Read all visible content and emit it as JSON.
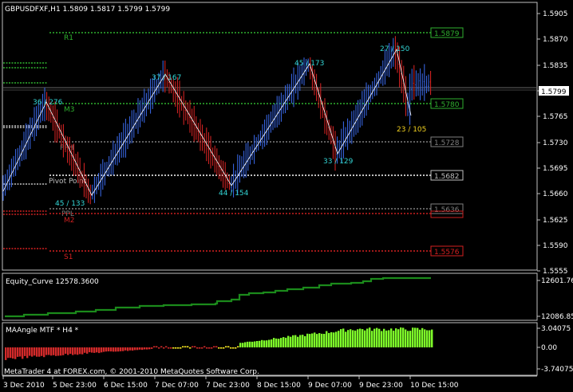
{
  "main_chart": {
    "header": "GBPUSDFXF,H1  1.5809 1.5817 1.5799 1.5799",
    "price_scale": [
      "1.5905",
      "1.5870",
      "1.5835",
      "1.5800",
      "1.5765",
      "1.5730",
      "1.5695",
      "1.5660",
      "1.5625",
      "1.5590",
      "1.5555"
    ],
    "current_price": "1.5799",
    "levels": [
      {
        "label": "R1",
        "price": "1.5879",
        "label_color": "#2fb12f",
        "line_color": "#2fb12f"
      },
      {
        "label": "M3",
        "price": "1.5780",
        "label_color": "#2fb12f",
        "line_color": "#2fb12f"
      },
      {
        "label": "PPH",
        "price": "1.5728",
        "label_color": "#7f7f7f",
        "line_color": "#7f7f7f"
      },
      {
        "label": "Pivot Point",
        "price": "1.5682",
        "label_color": "#bfbfbf",
        "line_color": "#bfbfbf"
      },
      {
        "label": "PPL",
        "price": "1.5636",
        "label_color": "#7f7f7f",
        "line_color": "#7f7f7f"
      },
      {
        "label": "M2",
        "price": "",
        "label_color": "#cc2020",
        "line_color": "#cc2020"
      },
      {
        "label": "S1",
        "price": "1.5576",
        "label_color": "#d42020",
        "line_color": "#d42020"
      }
    ],
    "zigzag_labels": [
      {
        "text": "36 / 276",
        "color": "#33d6d6"
      },
      {
        "text": "45 / 133",
        "color": "#33d6d6"
      },
      {
        "text": "37 / 167",
        "color": "#33d6d6"
      },
      {
        "text": "44 / 154",
        "color": "#33d6d6"
      },
      {
        "text": "45 / 173",
        "color": "#33d6d6"
      },
      {
        "text": "33 / 129",
        "color": "#33d6d6"
      },
      {
        "text": "27 / 150",
        "color": "#33d6d6"
      },
      {
        "text": "23 / 105",
        "color": "#f0d020"
      }
    ]
  },
  "equity_panel": {
    "title": "Equity_Curve 12578.3600",
    "scale": [
      "12601.76",
      "12086.85"
    ],
    "line_color": "#1b8a1b"
  },
  "ma_panel": {
    "title": "MAAngle MTF * H4 *",
    "scale": [
      "3.04075",
      "0.00",
      "-3.74075"
    ]
  },
  "time_axis": [
    "3 Dec 2010",
    "5 Dec 23:00",
    "6 Dec 15:00",
    "7 Dec 07:00",
    "7 Dec 23:00",
    "8 Dec 15:00",
    "9 Dec 07:00",
    "9 Dec 23:00",
    "10 Dec 15:00"
  ],
  "watermark": "MetaTrader 4 at FOREX.com, © 2001-2010 MetaQuotes Software Corp.",
  "colors": {
    "bull_bar": "#3b6cf0",
    "bear_bar": "#e02525",
    "zigzag": "#ffffff",
    "ma_positive": "#7fff2a",
    "ma_negative": "#d22a2a",
    "ma_neutral": "#ffee22",
    "frame": "#c0c0c0"
  }
}
